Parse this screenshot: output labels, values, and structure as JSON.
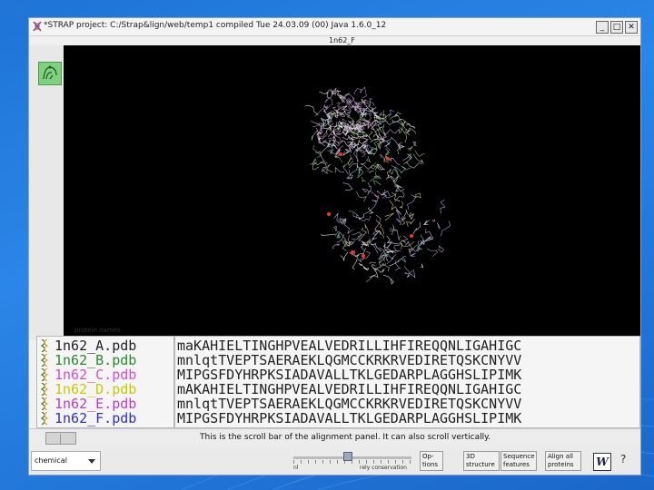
{
  "window": {
    "title": "*STRAP project: C:/Strap&lign/web/temp1  compiled Tue 24.03.09  (00)  Java 1.6.0_12",
    "minimize_symbol": "_",
    "maximize_symbol": "□",
    "close_symbol": "✕"
  },
  "viewer": {
    "label": "1n62_F"
  },
  "names_panel": {
    "label": "protein names",
    "items": [
      {
        "text": "1n62_A.pdb",
        "color": "#222222"
      },
      {
        "text": "1n62_B.pdb",
        "color": "#2a8a2a"
      },
      {
        "text": "1n62_C.pdb",
        "color": "#d24fd2"
      },
      {
        "text": "1n62_D.pdb",
        "color": "#c9c900"
      },
      {
        "text": "1n62_E.pdb",
        "color": "#c03bc0"
      },
      {
        "text": "1n62_F.pdb",
        "color": "#2f2fcc"
      }
    ]
  },
  "alignment": {
    "rows": [
      "maKAHIELTINGHPVEALVEDRILLIHFIREQQNLIGAHIGC",
      "mnlqtTVEPTSAERAEKLQGMCCKRKRVEDIRETQSKCNYVV",
      "MIPGSFDYHRPKSIADAVALLTKLGEDARPLAGGHSLIPIMK",
      "mAKAHIELTINGHPVEALVEDRILLIHFIREQQNLIGAHIGC",
      "mnlqtTVEPTSAERAEKLQGMCCKRKRVEDIRETQSKCNYVV",
      "MIPGSFDYHRPKSIADAVALLTKLGEDARPLAGGHSLIPIMK"
    ]
  },
  "scrollbar": {
    "message": "This is the scroll bar of the alignment panel. It can also scroll vertically."
  },
  "toolbar": {
    "coloring_select_value": "chemical",
    "slider_label_left": "nl",
    "slider_label": "rely conservation",
    "btn_options": "Op-\ntions",
    "btn_3d": "3D\nstructure",
    "btn_sequence": "Sequence\nfeatures",
    "btn_align": "Align all\nproteins",
    "w_label": "W",
    "help_label": "?"
  },
  "colors": {
    "background": "#1f74d6",
    "viewer": "#000000"
  }
}
